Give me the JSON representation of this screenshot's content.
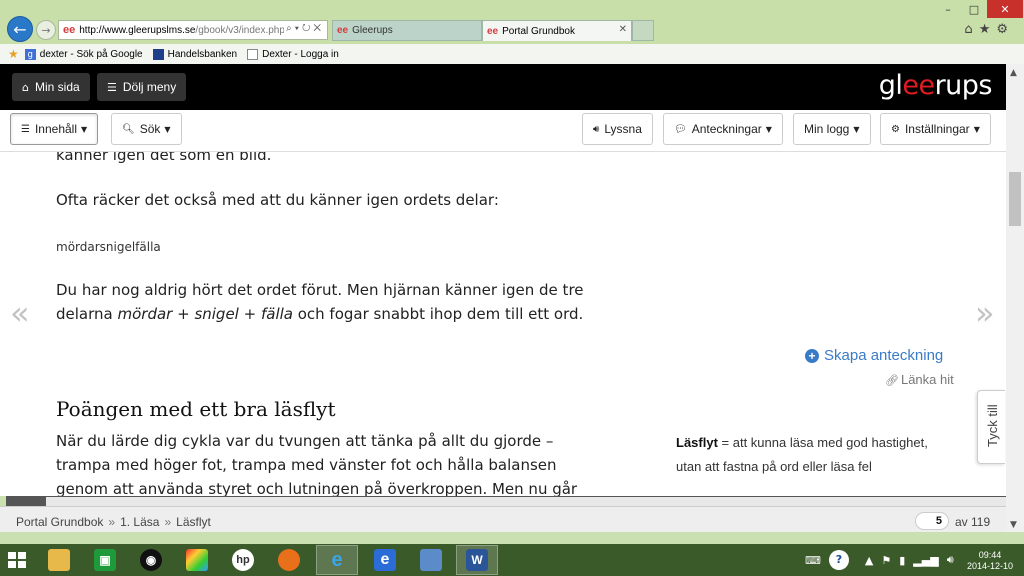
{
  "browser": {
    "address": {
      "host": "http://www.gleerupslms.se",
      "path": "/gbook/v3/index.php?id="
    },
    "tabs": [
      {
        "label": "Gleerups"
      },
      {
        "label": "Portal Grundbok"
      }
    ],
    "favorites": [
      {
        "label": "dexter - Sök på Google",
        "icon": "google-icon"
      },
      {
        "label": "Handelsbanken",
        "icon": "handelsbanken-icon"
      },
      {
        "label": "Dexter - Logga in",
        "icon": "page-icon"
      }
    ]
  },
  "header": {
    "buttons": {
      "min_sida": "Min sida",
      "dolj_meny": "Dölj meny"
    },
    "logo": {
      "part1": "gl",
      "part2": "ee",
      "part3": "rups"
    }
  },
  "toolbar": {
    "innehall": "Innehåll",
    "sok": "Sök",
    "lyssna": "Lyssna",
    "anteckningar": "Anteckningar",
    "min_logg": "Min logg",
    "installningar": "Inställningar"
  },
  "content": {
    "clipped_line": "känner igen det som en bild.",
    "ofta": "Ofta räcker det också med att du känner igen ordets delar:",
    "example_word": "mördarsnigelfälla",
    "hort_line1": "Du har nog aldrig hört det ordet förut. Men hjärnan känner igen de tre",
    "hort_line2_a": "delarna ",
    "hort_em1": "mördar",
    "hort_plus1": " + ",
    "hort_em2": "snigel",
    "hort_plus2": " + ",
    "hort_em3": "fälla",
    "hort_line2_b": " och fogar snabbt ihop dem till ett ord.",
    "skapa_anteckning": "Skapa anteckning",
    "lanka_hit": "Länka hit",
    "heading": "Poängen med ett bra läsflyt",
    "cykla_line1": "När du lärde dig cykla var du tvungen att tänka på allt du gjorde –",
    "cykla_line2": "trampa med höger fot, trampa med vänster fot och hålla balansen",
    "cykla_line3": "genom att använda styret och lutningen på överkroppen. Men nu går",
    "sidenote_term": "Läsflyt",
    "sidenote_text": " = att kunna läsa med god hastighet, utan att fastna på ord eller läsa fel",
    "tyck_till": "Tyck till"
  },
  "progress": {
    "value": 0.04
  },
  "footer": {
    "breadcrumb": [
      "Portal Grundbok",
      "1. Läsa",
      "Läsflyt"
    ],
    "separator": "»",
    "current_page": "5",
    "total": "av 119"
  },
  "taskbar": {
    "apps": [
      "file-explorer",
      "store",
      "media-player",
      "paint",
      "hp",
      "firefox",
      "internet-explorer",
      "internet-explorer-2",
      "remote-desktop",
      "word"
    ],
    "clock_time": "09:44",
    "clock_date": "2014-12-10"
  },
  "colors": {
    "chrome_bg": "#c9dfa9",
    "header_bg": "#000000",
    "link_blue": "#3a7bc8",
    "logo_red": "#e01b22",
    "taskbar_bg": "#3b5a2a"
  }
}
